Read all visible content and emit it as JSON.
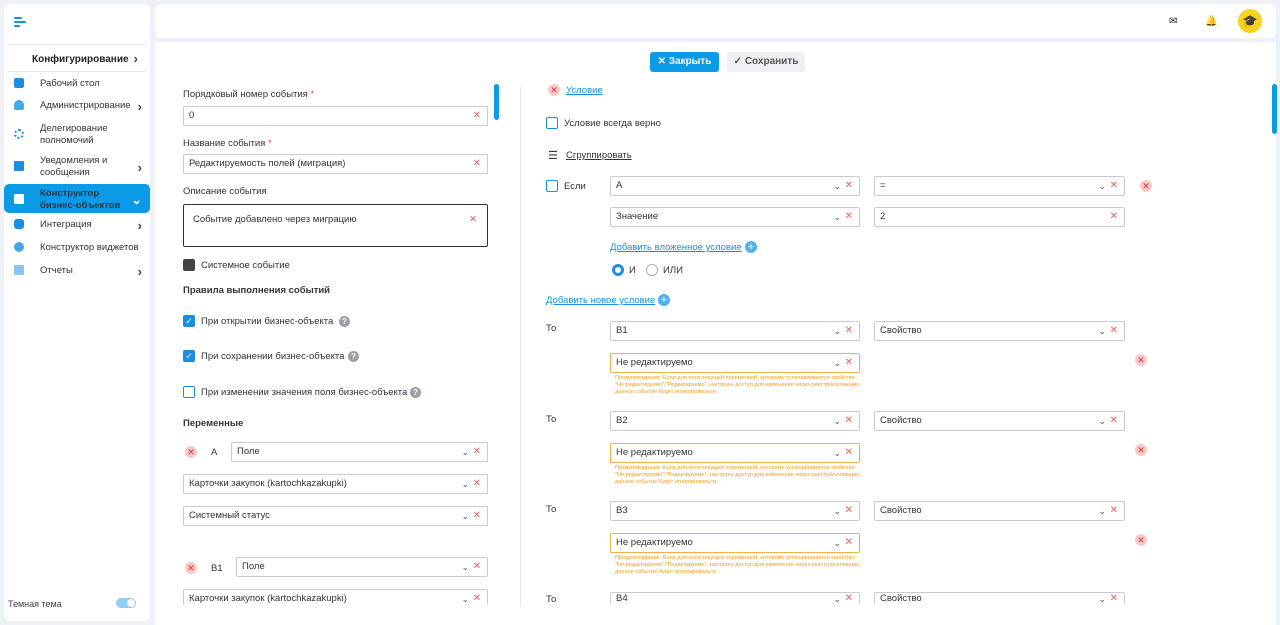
{
  "sidebar": {
    "section": "Конфигурирование",
    "items": [
      {
        "label1": "Рабочий стол",
        "label2": ""
      },
      {
        "label1": "Администрирование",
        "label2": ""
      },
      {
        "label1": "Делегирование",
        "label2": "полномочий"
      },
      {
        "label1": "Уведомления и",
        "label2": "сообщения"
      },
      {
        "label1": "Конструктор",
        "label2": "бизнес-объектов"
      },
      {
        "label1": "Интеграция",
        "label2": ""
      },
      {
        "label1": "Конструктор виджетов",
        "label2": ""
      },
      {
        "label1": "Отчеты",
        "label2": ""
      }
    ],
    "theme_label": "Темная тема"
  },
  "toolbar": {
    "close": "Закрыть",
    "save": "Сохранить"
  },
  "left": {
    "order_label": "Порядковый номер события",
    "order_value": "0",
    "name_label": "Название события",
    "name_value": "Редактируемость полей (миграция)",
    "desc_label": "Описание события",
    "desc_value": "Событие добавлено через миграцию",
    "system_event": "Системное событие",
    "rules_title": "Правила выполнения событий",
    "rule_open": "При открытии бизнес-объекта",
    "rule_save": "При сохранении бизнес-объекта",
    "rule_change": "При изменении значения поля бизнес-объекта",
    "vars_title": "Переменные",
    "var_a": "A",
    "var_b1": "B1",
    "field": "Поле",
    "cards": "Карточки закупок (kartochkazakupki)",
    "status": "Системный статус",
    "required": "*"
  },
  "right": {
    "condition": "Условие",
    "always_true": "Условие всегда верно",
    "group": "Сгруппировать",
    "if": "Если",
    "cond_a": "A",
    "cond_op": "=",
    "cond_value_type": "Значение",
    "cond_value": "2",
    "add_nested": "Добавить вложенное условие",
    "and": "И",
    "or": "ИЛИ",
    "add_new": "Добавить новое условие",
    "then": "То",
    "property": "Свойство",
    "not_editable": "Не редактируемо",
    "warning": "Предупреждение: Если для поля текущей переменной, которому устанавливается свойство \"Не редактируемо\"/\"Редактируемо\", настроен доступ для изменения через реестр/коллекцию, данное событие будет игнорироваться.",
    "b1": "B1",
    "b2": "B2",
    "b3": "B3",
    "b4": "B4"
  }
}
